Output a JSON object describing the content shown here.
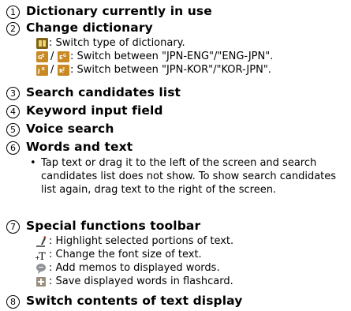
{
  "items": [
    {
      "num": "1",
      "title": "Dictionary currently in use"
    },
    {
      "num": "2",
      "title": "Change dictionary",
      "subs": [
        {
          "text": ": Switch type of dictionary.",
          "icon": "dictionary-book-icon"
        },
        {
          "text": ": Switch between \"JPN-ENG\"/\"ENG-JPN\".",
          "icon": "language-swap-icon",
          "slash": "/"
        },
        {
          "text": ": Switch between \"JPN-KOR\"/\"KOR-JPN\".",
          "icon": "language-swap-icon",
          "slash": "/"
        }
      ]
    },
    {
      "num": "3",
      "title": "Search candidates list"
    },
    {
      "num": "4",
      "title": "Keyword input field"
    },
    {
      "num": "5",
      "title": "Voice search"
    },
    {
      "num": "6",
      "title": "Words and text",
      "bullet": "•",
      "paragraph": "Tap text or drag it to the left of the screen and search candidates list does not show. To show search candidates list again, drag text to the right of the screen."
    },
    {
      "num": "7",
      "title": "Special functions toolbar",
      "subs": [
        {
          "text": ": Highlight selected portions of text.",
          "icon": "highlighter-pen-icon"
        },
        {
          "text": ": Change the font size of text.",
          "icon": "font-size-icon"
        },
        {
          "text": ": Add memos to displayed words.",
          "icon": "memo-bubble-icon"
        },
        {
          "text": ": Save displayed words in flashcard.",
          "icon": "flashcard-icon"
        }
      ]
    },
    {
      "num": "8",
      "title": "Switch contents of text display"
    }
  ],
  "colors": {
    "text": "#000000",
    "icon_book": "#8a6d1c",
    "icon_lang": "#c9902a",
    "icon_memo": "#8f9296",
    "icon_flashcard": "#9a8f7f"
  }
}
